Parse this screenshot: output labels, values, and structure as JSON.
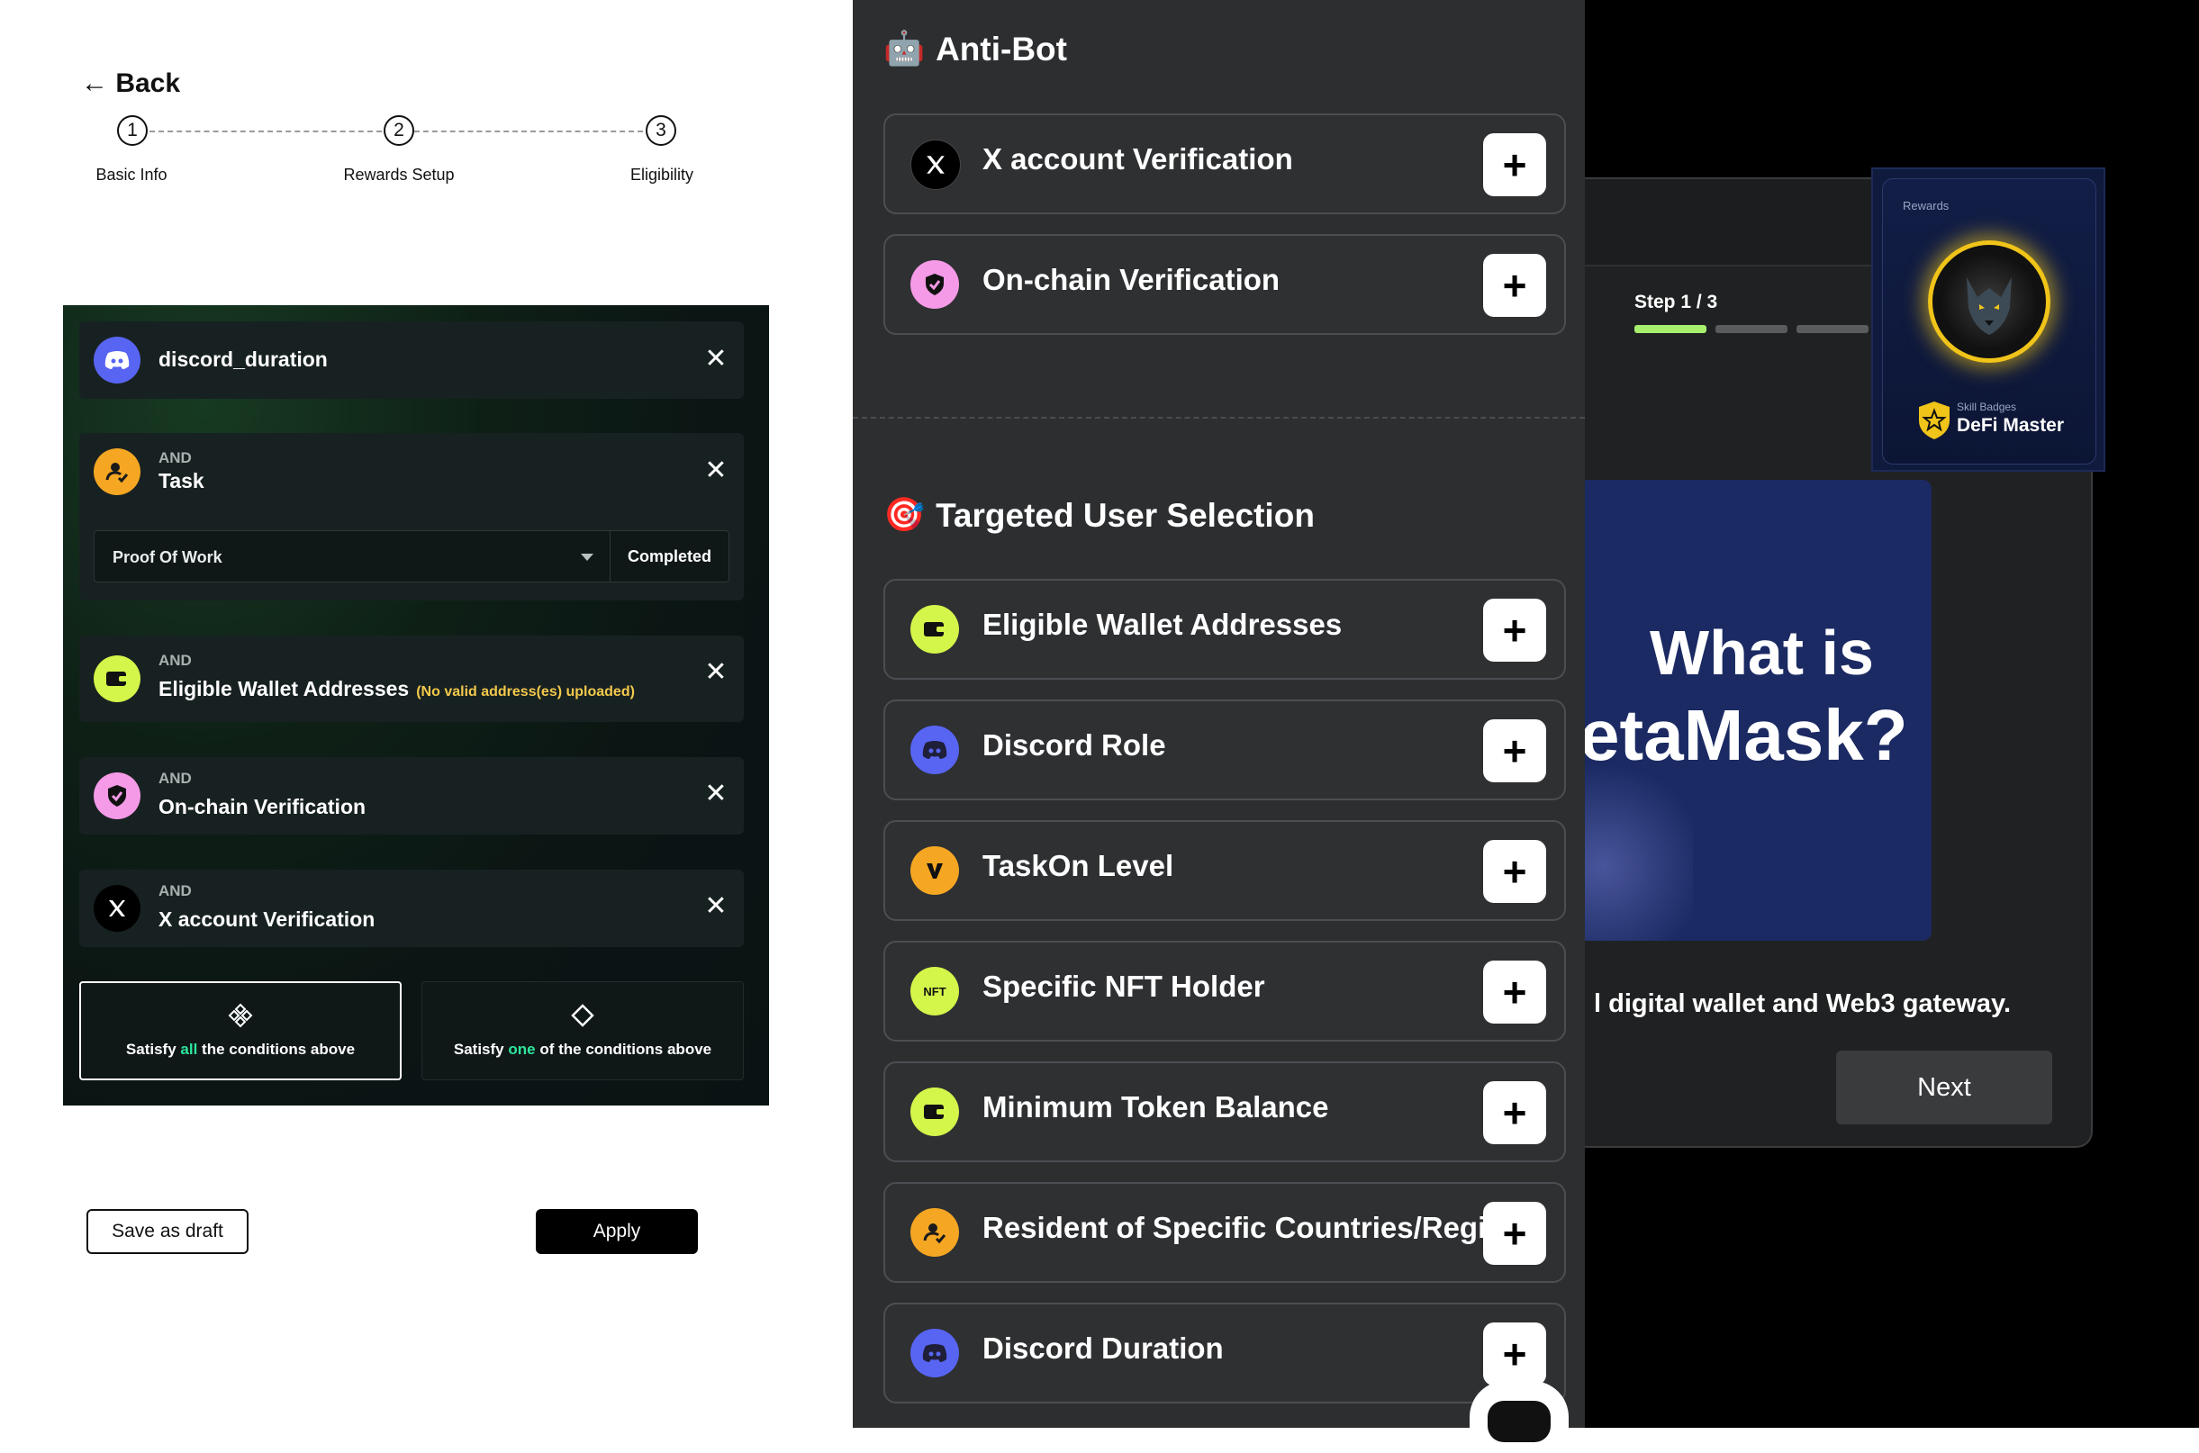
{
  "left": {
    "back_label": "← Back",
    "steps": [
      {
        "num": "1",
        "label": "Basic Info"
      },
      {
        "num": "2",
        "label": "Rewards Setup"
      },
      {
        "num": "3",
        "label": "Eligibility"
      }
    ],
    "conditions": {
      "discord": {
        "title": "discord_duration"
      },
      "task": {
        "and": "AND",
        "title": "Task",
        "select_value": "Proof Of Work",
        "status": "Completed"
      },
      "wallet": {
        "and": "AND",
        "title": "Eligible Wallet Addresses",
        "note": "(No valid address(es) uploaded)"
      },
      "onchain": {
        "and": "AND",
        "title": "On-chain Verification"
      },
      "xaccount": {
        "and": "AND",
        "title": "X account Verification"
      },
      "close_glyph": "✕"
    },
    "logic": {
      "all": {
        "prefix": "Satisfy",
        "highlight": "all",
        "suffix": "the conditions above"
      },
      "one": {
        "prefix": "Satisfy",
        "highlight": "one",
        "suffix": "of the conditions above"
      }
    },
    "save_draft": "Save as draft",
    "apply": "Apply"
  },
  "middle": {
    "anti_bot": {
      "emoji": "🤖",
      "title": "Anti-Bot",
      "items": [
        "X account Verification",
        "On-chain Verification"
      ]
    },
    "targeted": {
      "emoji": "🎯",
      "title": "Targeted User Selection",
      "items": [
        "Eligible Wallet Addresses",
        "Discord Role",
        "TaskOn Level",
        "Specific NFT Holder",
        "Minimum Token Balance",
        "Resident of Specific Countries/Regions",
        "Discord Duration"
      ]
    },
    "add_glyph": "+"
  },
  "right": {
    "step_text": "Step 1 / 3",
    "progress": {
      "current_step": 1,
      "total_steps": 3
    },
    "hero_line1": "What is",
    "hero_line2": "etaMask?",
    "description": "l digital wallet and Web3 gateway.",
    "next_button": "Next",
    "reward": {
      "label": "Rewards",
      "badge_small": "Skill Badges",
      "badge_name": "DeFi Master"
    }
  },
  "colors": {
    "discord": "#5865F2",
    "task": "#F5A623",
    "wallet": "#D4F54A",
    "onchain": "#F49AE6",
    "x": "#000000",
    "taskon": "#F5A623",
    "nft": "#D4F54A",
    "progress_active": "#A6F06E",
    "progress_inactive": "#5a5b5d",
    "highlight": "#2ee59d"
  }
}
